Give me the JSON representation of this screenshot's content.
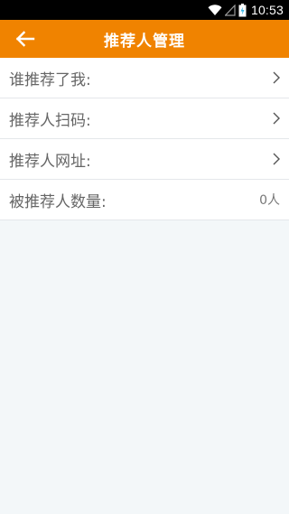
{
  "status_bar": {
    "time": "10:53",
    "icons": [
      "wifi-icon",
      "signal-icon",
      "battery-charging-icon"
    ]
  },
  "app_bar": {
    "title": "推荐人管理",
    "back_icon": "arrow-left-icon",
    "color": "#f08300"
  },
  "rows": [
    {
      "label": "谁推荐了我:",
      "trailing": "chevron-right-icon"
    },
    {
      "label": "推荐人扫码:",
      "trailing": "chevron-right-icon"
    },
    {
      "label": "推荐人网址:",
      "trailing": "chevron-right-icon"
    },
    {
      "label": "被推荐人数量:",
      "value": "0人"
    }
  ]
}
